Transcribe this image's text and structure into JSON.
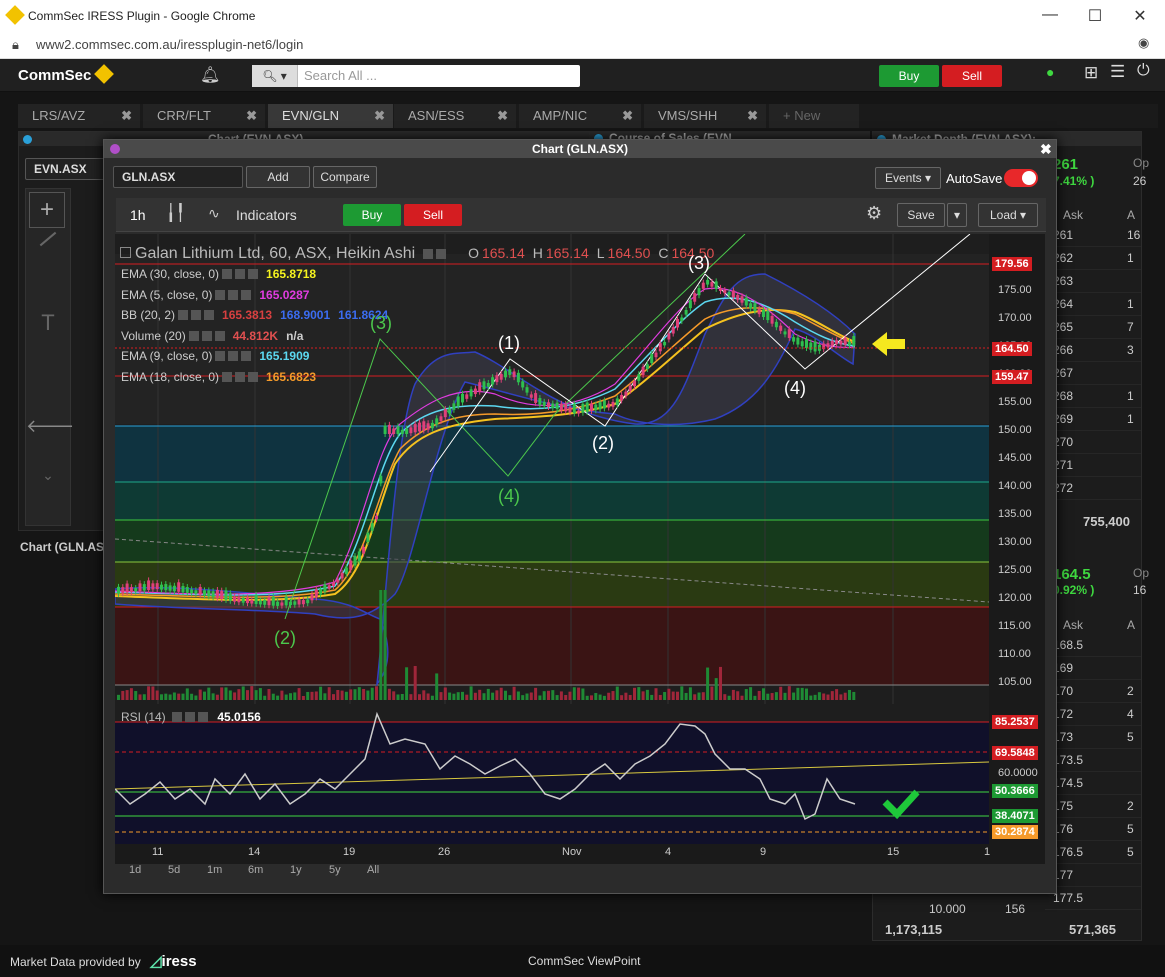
{
  "browser": {
    "title": "CommSec IRESS Plugin - Google Chrome",
    "url": "www2.commsec.com.au/iressplugin-net6/login"
  },
  "header": {
    "logo": "CommSec",
    "search_placeholder": "Search All ...",
    "buy": "Buy",
    "sell": "Sell"
  },
  "tabs": [
    "LRS/AVZ",
    "CRR/FLT",
    "EVN/GLN",
    "ASN/ESS",
    "AMP/NIC",
    "VMS/SHH",
    "+ New"
  ],
  "panes": {
    "left_title": "Chart (EVN.ASX)",
    "left_symbol": "EVN.ASX",
    "left_bottom": "Chart (GLN.ASX",
    "cos_title": "Course of Sales (EVN...",
    "md_title": "Market Depth (EVN.ASX):",
    "md_top": {
      "price": "261",
      "change": "7.41% )",
      "op": "Op",
      "op_val": "26"
    },
    "ask_hdr": "Ask",
    "a_hdr": "A",
    "asks_top": [
      [
        "261",
        "16"
      ],
      [
        "262",
        "1"
      ],
      [
        "263",
        ""
      ],
      [
        "264",
        "1"
      ],
      [
        "265",
        "7"
      ],
      [
        "266",
        "3"
      ],
      [
        "267",
        ""
      ],
      [
        "268",
        "1"
      ],
      [
        "269",
        "1"
      ],
      [
        "270",
        ""
      ],
      [
        "271",
        ""
      ],
      [
        "272",
        ""
      ]
    ],
    "total_top": "755,400",
    "md_bot": {
      "price": "164.5",
      "change": "0.92% )",
      "op": "Op",
      "op_val": "16"
    },
    "asks_bot": [
      [
        "168.5",
        ""
      ],
      [
        "169",
        ""
      ],
      [
        "170",
        "2"
      ],
      [
        "172",
        "4"
      ],
      [
        "173",
        "5"
      ],
      [
        "173.5",
        ""
      ],
      [
        "174.5",
        ""
      ],
      [
        "175",
        "2"
      ],
      [
        "176",
        "5"
      ],
      [
        "176.5",
        "5"
      ],
      [
        "177",
        ""
      ],
      [
        "177.5",
        ""
      ]
    ],
    "bottom_row": [
      "10.000",
      "156"
    ],
    "totals_bot": [
      "1,173,115",
      "571,365"
    ]
  },
  "window": {
    "title": "Chart (GLN.ASX)",
    "symbol": "GLN.ASX",
    "add": "Add",
    "compare": "Compare",
    "events": "Events",
    "autosave": "AutoSave",
    "interval": "1h",
    "indicators": "Indicators",
    "buy": "Buy",
    "sell": "Sell",
    "save": "Save",
    "load": "Load"
  },
  "legend": {
    "main": "Galan Lithium Ltd, 60, ASX, Heikin Ashi",
    "ohlc": [
      {
        "k": "O",
        "v": "165.14"
      },
      {
        "k": "H",
        "v": "165.14"
      },
      {
        "k": "L",
        "v": "164.50"
      },
      {
        "k": "C",
        "v": "164.50"
      }
    ],
    "rows": [
      {
        "name": "EMA (30, close, 0)",
        "vals": [
          {
            "v": "165.8718",
            "c": "#f5f31f"
          }
        ]
      },
      {
        "name": "EMA (5, close, 0)",
        "vals": [
          {
            "v": "165.0287",
            "c": "#e03ce0"
          }
        ]
      },
      {
        "name": "BB (20, 2)",
        "vals": [
          {
            "v": "165.3813",
            "c": "#d84040"
          },
          {
            "v": "168.9001",
            "c": "#3b6cf0"
          },
          {
            "v": "161.8624",
            "c": "#3b6cf0"
          }
        ]
      },
      {
        "name": "Volume (20)",
        "vals": [
          {
            "v": "44.812K",
            "c": "#e05050"
          },
          {
            "v": "n/a",
            "c": "#ccc"
          }
        ]
      },
      {
        "name": "EMA (9, close, 0)",
        "vals": [
          {
            "v": "165.1909",
            "c": "#5cd8f0"
          }
        ]
      },
      {
        "name": "EMA (18, close, 0)",
        "vals": [
          {
            "v": "165.6823",
            "c": "#f59a2a"
          }
        ]
      }
    ]
  },
  "price_axis": [
    "175.00",
    "170.00",
    "165.00",
    "160.00",
    "155.00",
    "150.00",
    "145.00",
    "140.00",
    "135.00",
    "130.00",
    "125.00",
    "120.00",
    "115.00",
    "110.00",
    "105.00"
  ],
  "price_tags": [
    {
      "v": "179.56",
      "c": "#d41d21"
    },
    {
      "v": "164.50",
      "c": "#d41d21"
    },
    {
      "v": "159.47",
      "c": "#d41d21"
    }
  ],
  "wave_labels": [
    {
      "t": "(3)",
      "c": "#4cc84c"
    },
    {
      "t": "(1)",
      "c": "#fff"
    },
    {
      "t": "(3)",
      "c": "#fff"
    },
    {
      "t": "(2)",
      "c": "#fff"
    },
    {
      "t": "(4)",
      "c": "#fff"
    },
    {
      "t": "(4)",
      "c": "#4cc84c"
    },
    {
      "t": "(2)",
      "c": "#4cc84c"
    }
  ],
  "rsi": {
    "label": "RSI (14)",
    "value": "45.0156",
    "axis": [
      "60.0000"
    ],
    "tags": [
      {
        "v": "85.2537",
        "c": "#d41d21"
      },
      {
        "v": "69.5848",
        "c": "#d41d21"
      },
      {
        "v": "50.3666",
        "c": "#1d9a33"
      },
      {
        "v": "38.4071",
        "c": "#1d9a33"
      },
      {
        "v": "30.2874",
        "c": "#f59a2a"
      }
    ]
  },
  "time_axis": [
    "11",
    "14",
    "19",
    "26",
    "Nov",
    "4",
    "9",
    "15",
    "1"
  ],
  "ranges": [
    "1d",
    "5d",
    "1m",
    "6m",
    "1y",
    "5y",
    "All"
  ],
  "footer": {
    "left": "Market Data provided by",
    "brand": "iress",
    "center": "CommSec ViewPoint"
  }
}
